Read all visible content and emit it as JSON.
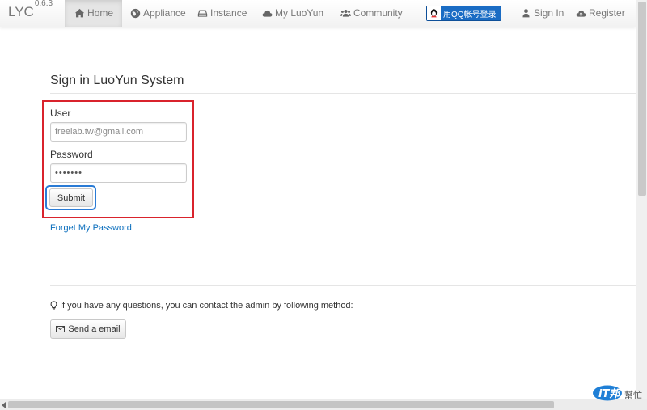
{
  "nav": {
    "brand": "LYC",
    "version": "0.6.3",
    "items": [
      {
        "label": "Home",
        "icon": "home-icon",
        "active": true
      },
      {
        "label": "Appliance",
        "icon": "globe-icon"
      },
      {
        "label": "Instance",
        "icon": "hdd-icon"
      },
      {
        "label": "My LuoYun",
        "icon": "cloud-icon"
      },
      {
        "label": "Community",
        "icon": "group-icon"
      }
    ],
    "qq_login": "用QQ帐号登录",
    "sign_in": "Sign In",
    "register": "Register"
  },
  "login": {
    "title": "Sign in LuoYun System",
    "user_label": "User",
    "user_value": "freelab.tw@gmail.com",
    "password_label": "Password",
    "password_value": "•••••••",
    "submit_label": "Submit",
    "forget_link": "Forget My Password"
  },
  "help": {
    "text": "If you have any questions, you can contact the admin by following method:",
    "email_button": "Send a email"
  },
  "watermark": {
    "brand": "iT邦",
    "sub": "幫忙"
  },
  "colors": {
    "annotation_red": "#d9232c",
    "annotation_blue": "#2a7bd5",
    "link": "#0a6ebd",
    "qq_blue": "#1a6cc4"
  }
}
